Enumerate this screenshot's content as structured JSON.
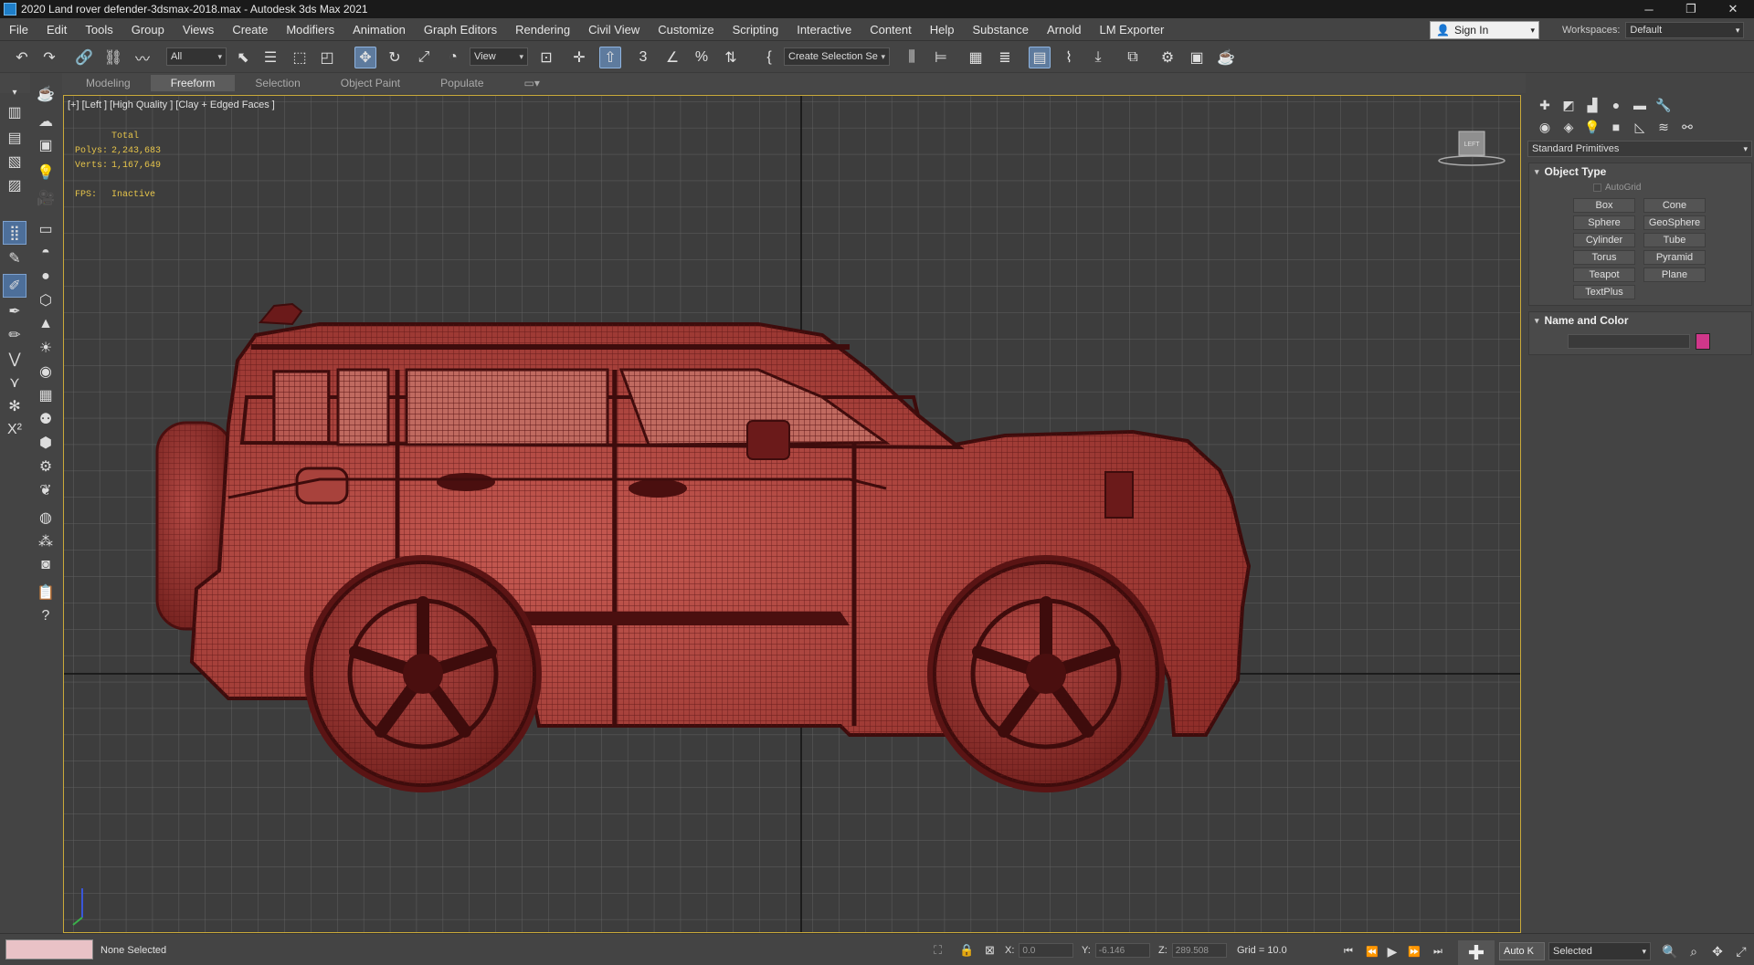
{
  "window": {
    "title": "2020 Land rover defender-3dsmax-2018.max - Autodesk 3ds Max 2021",
    "minimize": "─",
    "restore": "❐",
    "close": "✕"
  },
  "menu": [
    "File",
    "Edit",
    "Tools",
    "Group",
    "Views",
    "Create",
    "Modifiers",
    "Animation",
    "Graph Editors",
    "Rendering",
    "Civil View",
    "Customize",
    "Scripting",
    "Interactive",
    "Content",
    "Help",
    "Substance",
    "Arnold",
    "LM Exporter"
  ],
  "account": {
    "sign_in": "Sign In",
    "workspaces_label": "Workspaces:",
    "workspace": "Default"
  },
  "toolbar": {
    "selection_filter": "All",
    "ref_coord": "View",
    "selection_set_placeholder": "Create Selection Se"
  },
  "ribbon": {
    "tabs": [
      "Modeling",
      "Freeform",
      "Selection",
      "Object Paint",
      "Populate"
    ],
    "active": "Freeform"
  },
  "viewport": {
    "label": "[+] [Left ] [High Quality ] [Clay + Edged Faces ]",
    "stats": {
      "total_label": "Total",
      "polys_label": "Polys:",
      "polys": "2,243,683",
      "verts_label": "Verts:",
      "verts": "1,167,649",
      "fps_label": "FPS:",
      "fps": "Inactive"
    },
    "viewcube_label": "LEFT"
  },
  "command_panel": {
    "category": "Standard Primitives",
    "object_type": {
      "title": "Object Type",
      "autogrid": "AutoGrid",
      "buttons": [
        "Box",
        "Cone",
        "Sphere",
        "GeoSphere",
        "Cylinder",
        "Tube",
        "Torus",
        "Pyramid",
        "Teapot",
        "Plane",
        "TextPlus"
      ]
    },
    "name_and_color": {
      "title": "Name and Color",
      "name_value": "",
      "color": "#d0378a"
    }
  },
  "status": {
    "selection": "None Selected",
    "x_label": "X:",
    "x": "0.0",
    "y_label": "Y:",
    "y": "-6.146",
    "z_label": "Z:",
    "z": "289.508",
    "grid": "Grid = 10.0",
    "auto_key": "Auto K",
    "key_mode": "Selected"
  },
  "colors": {
    "wire": "#6b1a1a",
    "wire_light": "#c8504a",
    "grid_bg": "#3d3d3d",
    "viewport_border": "#c9a93a",
    "active_tool": "#5e7b9e"
  }
}
